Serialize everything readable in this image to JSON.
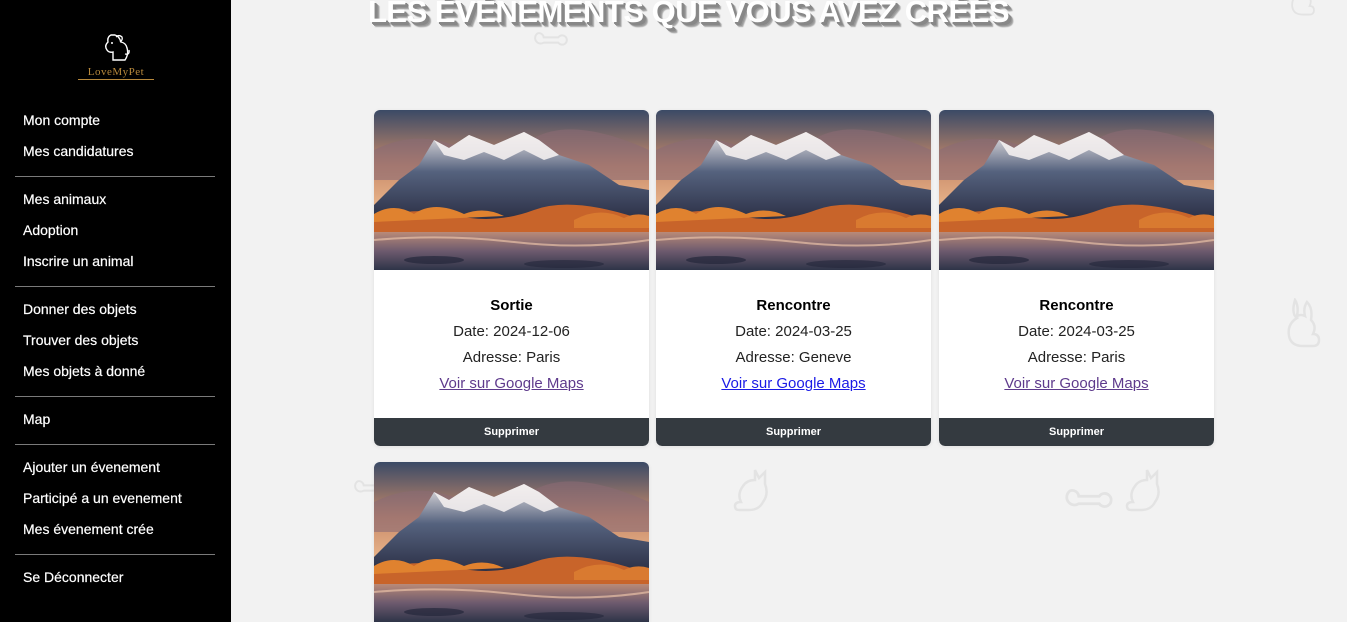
{
  "sidebar": {
    "logo_text": "LoveMyPet",
    "groups": [
      {
        "items": [
          {
            "label": "Mon compte"
          },
          {
            "label": "Mes candidatures"
          }
        ]
      },
      {
        "items": [
          {
            "label": "Mes animaux"
          },
          {
            "label": "Adoption"
          },
          {
            "label": "Inscrire un animal"
          }
        ]
      },
      {
        "items": [
          {
            "label": "Donner des objets"
          },
          {
            "label": "Trouver des objets"
          },
          {
            "label": "Mes objets à donné"
          }
        ]
      },
      {
        "items": [
          {
            "label": "Map"
          }
        ]
      },
      {
        "items": [
          {
            "label": "Ajouter un évenement"
          },
          {
            "label": "Participé a un evenement"
          },
          {
            "label": "Mes évenement crée"
          }
        ]
      },
      {
        "items": [
          {
            "label": "Se Déconnecter"
          }
        ]
      }
    ]
  },
  "main": {
    "title": "LES ÉVÉNEMENTS QUE VOUS AVEZ CRÉÉS",
    "events": [
      {
        "title": "Sortie",
        "date": "Date: 2024-12-06",
        "address": "Adresse: Paris",
        "link": "Voir sur Google Maps",
        "delete": "Supprimer"
      },
      {
        "title": "Rencontre",
        "date": "Date: 2024-03-25",
        "address": "Adresse: Geneve",
        "link": "Voir sur Google Maps",
        "delete": "Supprimer"
      },
      {
        "title": "Rencontre",
        "date": "Date: 2024-03-25",
        "address": "Adresse: Paris",
        "link": "Voir sur Google Maps",
        "delete": "Supprimer"
      }
    ]
  },
  "colors": {
    "sidebar_bg": "#000000",
    "main_bg": "#f2f2f2",
    "button_bg": "#343a40",
    "link_visited": "#5e3a8c",
    "link": "#1a1ae6",
    "logo_gold": "#b8893c"
  }
}
